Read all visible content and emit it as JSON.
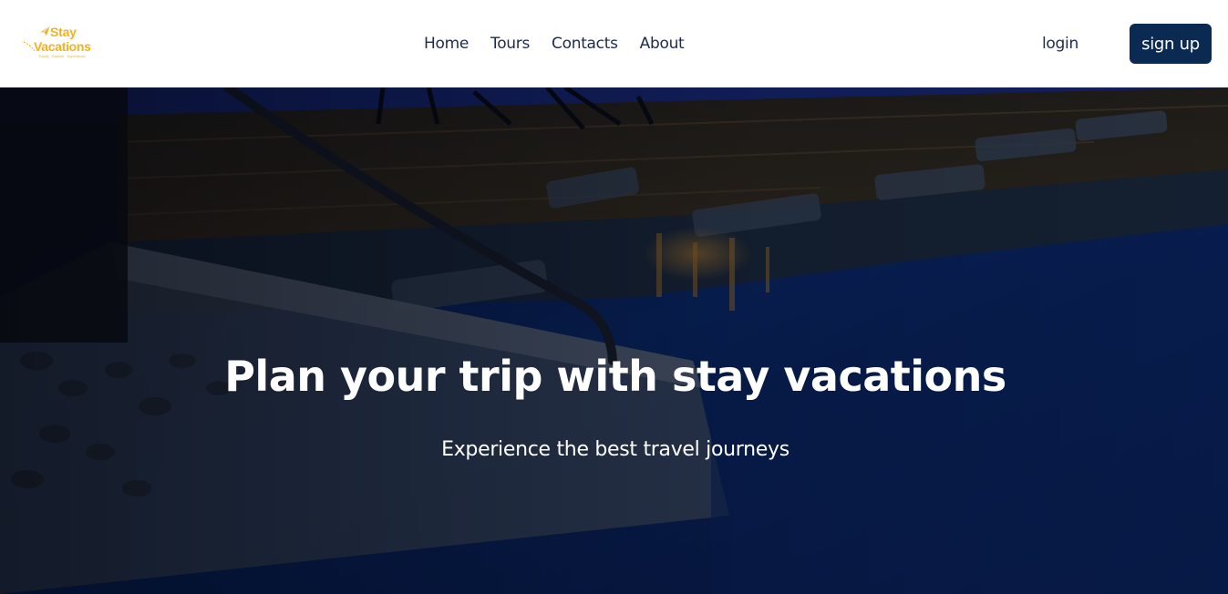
{
  "brand": {
    "line1": "Stay",
    "line2": "Vacations",
    "tagline": "Travel · Explore · Experience",
    "accent_color": "#f2b21c",
    "icon": "paper-plane-icon"
  },
  "nav": {
    "links": [
      {
        "label": "Home"
      },
      {
        "label": "Tours"
      },
      {
        "label": "Contacts"
      },
      {
        "label": "About"
      }
    ],
    "login_label": "login",
    "signup_label": "sign up",
    "text_color": "#1d2b4f",
    "button_color": "#0b2a52"
  },
  "hero": {
    "title": "Plan your trip with stay vacations",
    "subtitle": "Experience the best travel journeys",
    "background": "night-pool-photo"
  }
}
